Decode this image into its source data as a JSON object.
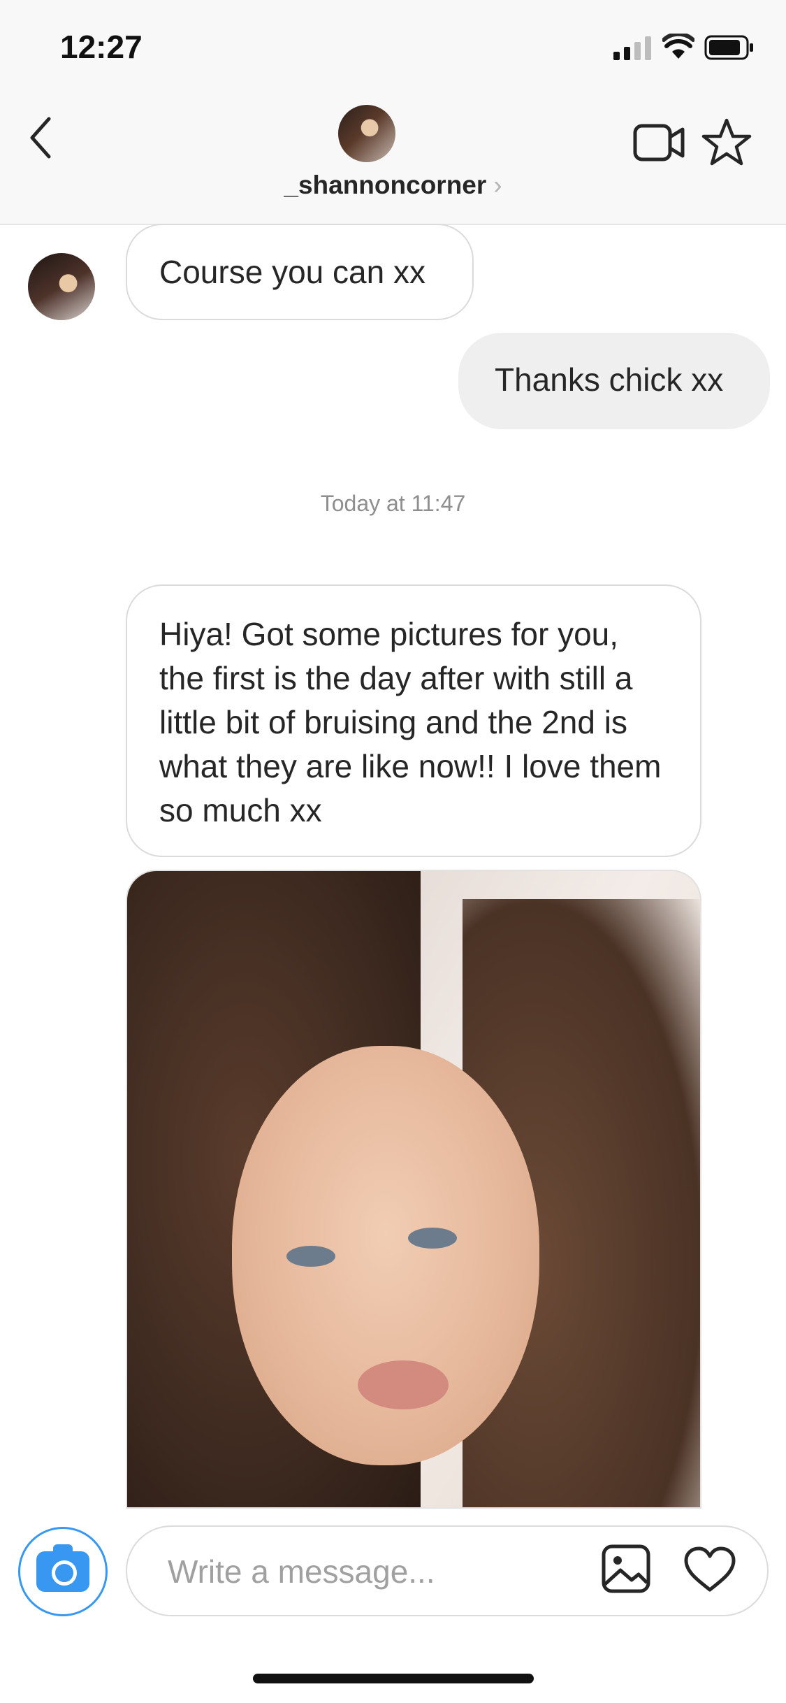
{
  "status_bar": {
    "time": "12:27"
  },
  "header": {
    "username": "_shannoncorner",
    "chevron": "›"
  },
  "messages": [
    {
      "from": "them",
      "text": "Course you can xx"
    },
    {
      "from": "me",
      "text": "Thanks chick xx"
    },
    {
      "type": "timestamp",
      "text": "Today at 11:47"
    },
    {
      "from": "them",
      "text": "Hiya! Got some pictures for you, the first is the day after with still a little bit of bruising and the 2nd is what they are like now!! I love them so much xx"
    },
    {
      "from": "them",
      "type": "photo"
    }
  ],
  "composer": {
    "placeholder": "Write a message..."
  },
  "colors": {
    "accent": "#3897f0",
    "outgoing_bubble": "#efefef"
  },
  "icons": [
    "back-icon",
    "video-call-icon",
    "star-icon",
    "camera-icon",
    "gallery-icon",
    "heart-icon"
  ]
}
